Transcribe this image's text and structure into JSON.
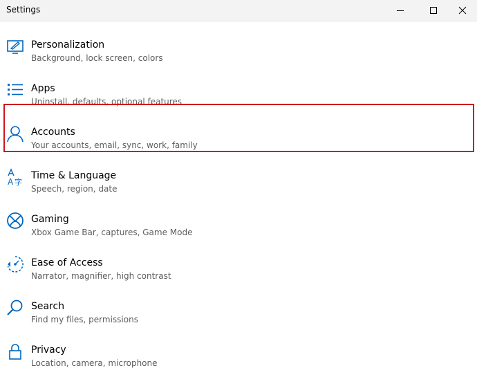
{
  "window": {
    "title": "Settings",
    "minimize_icon": "minimize-icon",
    "maximize_icon": "maximize-icon",
    "close_icon": "close-icon"
  },
  "accent_color": "#0067c0",
  "highlight_color": "#d0121b",
  "items": [
    {
      "label": "Personalization",
      "desc": "Background, lock screen, colors",
      "icon": "personalization-icon"
    },
    {
      "label": "Apps",
      "desc": "Uninstall, defaults, optional features",
      "icon": "apps-icon"
    },
    {
      "label": "Accounts",
      "desc": "Your accounts, email, sync, work, family",
      "icon": "person-icon"
    },
    {
      "label": "Time & Language",
      "desc": "Speech, region, date",
      "icon": "time-language-icon"
    },
    {
      "label": "Gaming",
      "desc": "Xbox Game Bar, captures, Game Mode",
      "icon": "xbox-icon"
    },
    {
      "label": "Ease of Access",
      "desc": "Narrator, magnifier, high contrast",
      "icon": "ease-of-access-icon"
    },
    {
      "label": "Search",
      "desc": "Find my files, permissions",
      "icon": "search-icon"
    },
    {
      "label": "Privacy",
      "desc": "Location, camera, microphone",
      "icon": "lock-icon"
    }
  ]
}
